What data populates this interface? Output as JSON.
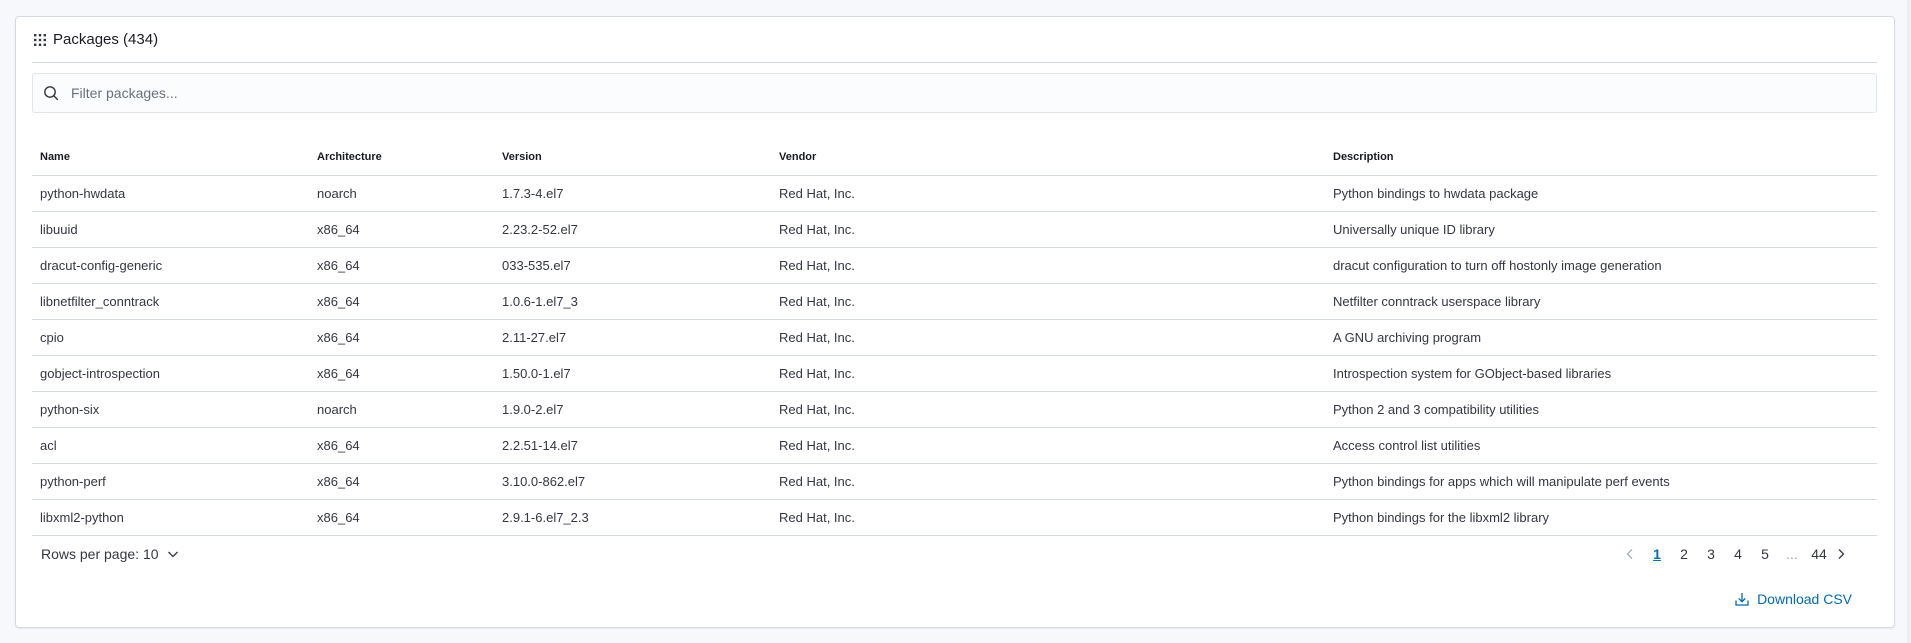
{
  "header": {
    "title": "Packages (434)",
    "icon": "grid-icon"
  },
  "search": {
    "placeholder": "Filter packages...",
    "value": ""
  },
  "table": {
    "columns": [
      "Name",
      "Architecture",
      "Version",
      "Vendor",
      "Description"
    ],
    "rows": [
      [
        "python-hwdata",
        "noarch",
        "1.7.3-4.el7",
        "Red Hat, Inc.",
        "Python bindings to hwdata package"
      ],
      [
        "libuuid",
        "x86_64",
        "2.23.2-52.el7",
        "Red Hat, Inc.",
        "Universally unique ID library"
      ],
      [
        "dracut-config-generic",
        "x86_64",
        "033-535.el7",
        "Red Hat, Inc.",
        "dracut configuration to turn off hostonly image generation"
      ],
      [
        "libnetfilter_conntrack",
        "x86_64",
        "1.0.6-1.el7_3",
        "Red Hat, Inc.",
        "Netfilter conntrack userspace library"
      ],
      [
        "cpio",
        "x86_64",
        "2.11-27.el7",
        "Red Hat, Inc.",
        "A GNU archiving program"
      ],
      [
        "gobject-introspection",
        "x86_64",
        "1.50.0-1.el7",
        "Red Hat, Inc.",
        "Introspection system for GObject-based libraries"
      ],
      [
        "python-six",
        "noarch",
        "1.9.0-2.el7",
        "Red Hat, Inc.",
        "Python 2 and 3 compatibility utilities"
      ],
      [
        "acl",
        "x86_64",
        "2.2.51-14.el7",
        "Red Hat, Inc.",
        "Access control list utilities"
      ],
      [
        "python-perf",
        "x86_64",
        "3.10.0-862.el7",
        "Red Hat, Inc.",
        "Python bindings for apps which will manipulate perf events"
      ],
      [
        "libxml2-python",
        "x86_64",
        "2.9.1-6.el7_2.3",
        "Red Hat, Inc.",
        "Python bindings for the libxml2 library"
      ]
    ]
  },
  "pagination": {
    "rows_per_page_label": "Rows per page: 10",
    "pages": [
      "1",
      "2",
      "3",
      "4",
      "5"
    ],
    "ellipsis": "...",
    "last_page": "44",
    "current": "1"
  },
  "download": {
    "label": "Download CSV",
    "icon": "download-icon"
  },
  "colors": {
    "accent": "#006bb8",
    "border": "#d3dae6",
    "text": "#343741",
    "background": "#f7f8fc"
  }
}
